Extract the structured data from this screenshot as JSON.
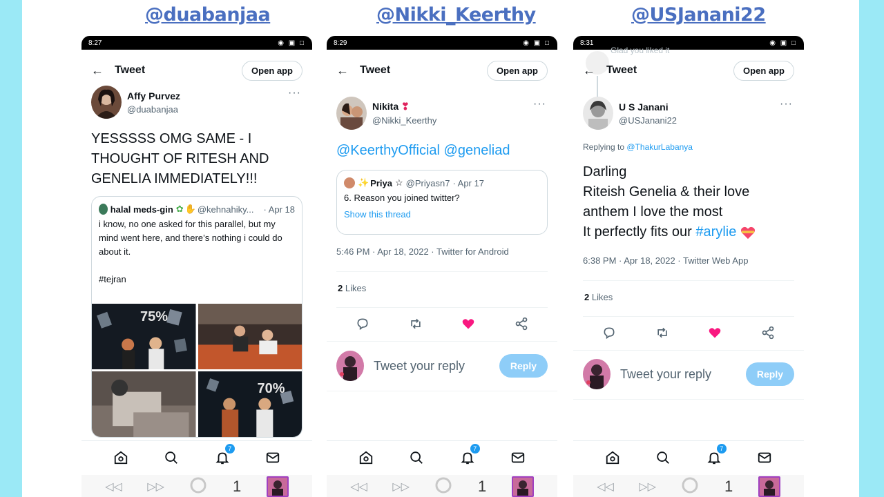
{
  "columns": [
    {
      "title": "@duabanjaa",
      "phone": {
        "time": "8:27",
        "header_title": "Tweet",
        "open_app": "Open app",
        "author_name": "Affy Purvez",
        "author_handle": "@duabanjaa",
        "tweet_text": "YESSSSS OMG SAME - I THOUGHT OF RITESH AND GENELIA IMMEDIATELY!!!",
        "quote": {
          "name": "halal meds-gin",
          "handle": "@kehnahiky...",
          "date": "· Apr 18",
          "text": "i know, no one asked for this parallel, but my mind went here, and there’s nothing i could do about it.",
          "hashtag": "#tejran",
          "overlay_1": "75%",
          "overlay_2": "70%"
        },
        "notif_badge": "7",
        "tab_count": "1"
      }
    },
    {
      "title": "@Nikki_Keerthy",
      "phone": {
        "time": "8:29",
        "header_title": "Tweet",
        "open_app": "Open app",
        "author_name": "Nikita",
        "author_handle": "@Nikki_Keerthy",
        "mentions": "@KeerthyOfficial @geneliad",
        "quote": {
          "name": "Priya",
          "handle": "@Priyasn7",
          "date": "· Apr 17",
          "text": "6. Reason you joined twitter?",
          "show_thread": "Show this thread"
        },
        "meta": "5:46 PM · Apr 18, 2022 · Twitter for Android",
        "likes_count": "2",
        "likes_label": "Likes",
        "reply_placeholder": "Tweet your reply",
        "reply_button": "Reply",
        "notif_badge": "7",
        "tab_count": "1"
      }
    },
    {
      "title": "@USJanani22",
      "phone": {
        "time": "8:31",
        "header_title": "Tweet",
        "open_app": "Open app",
        "faded_text": "Glad you liked it",
        "author_name": "U S Janani",
        "author_handle": "@USJanani22",
        "replying_to_label": "Replying to",
        "replying_to_handle": "@ThakurLabanya",
        "line1": "Darling",
        "line2": "Riteish Genelia & their love",
        "line3": "anthem I love the most",
        "line4_prefix": "It perfectly fits our",
        "hashtag": "#arylie",
        "meta": "6:38 PM · Apr 18, 2022 · Twitter Web App",
        "likes_count": "2",
        "likes_label": "Likes",
        "reply_placeholder": "Tweet your reply",
        "reply_button": "Reply",
        "notif_badge": "7",
        "tab_count": "1"
      }
    }
  ],
  "colors": {
    "background": "#9be9f6",
    "title_link": "#4a6fc0",
    "twitter_blue": "#1d9bf0",
    "like_pink": "#f91880",
    "reply_button": "#8ecdf8"
  }
}
